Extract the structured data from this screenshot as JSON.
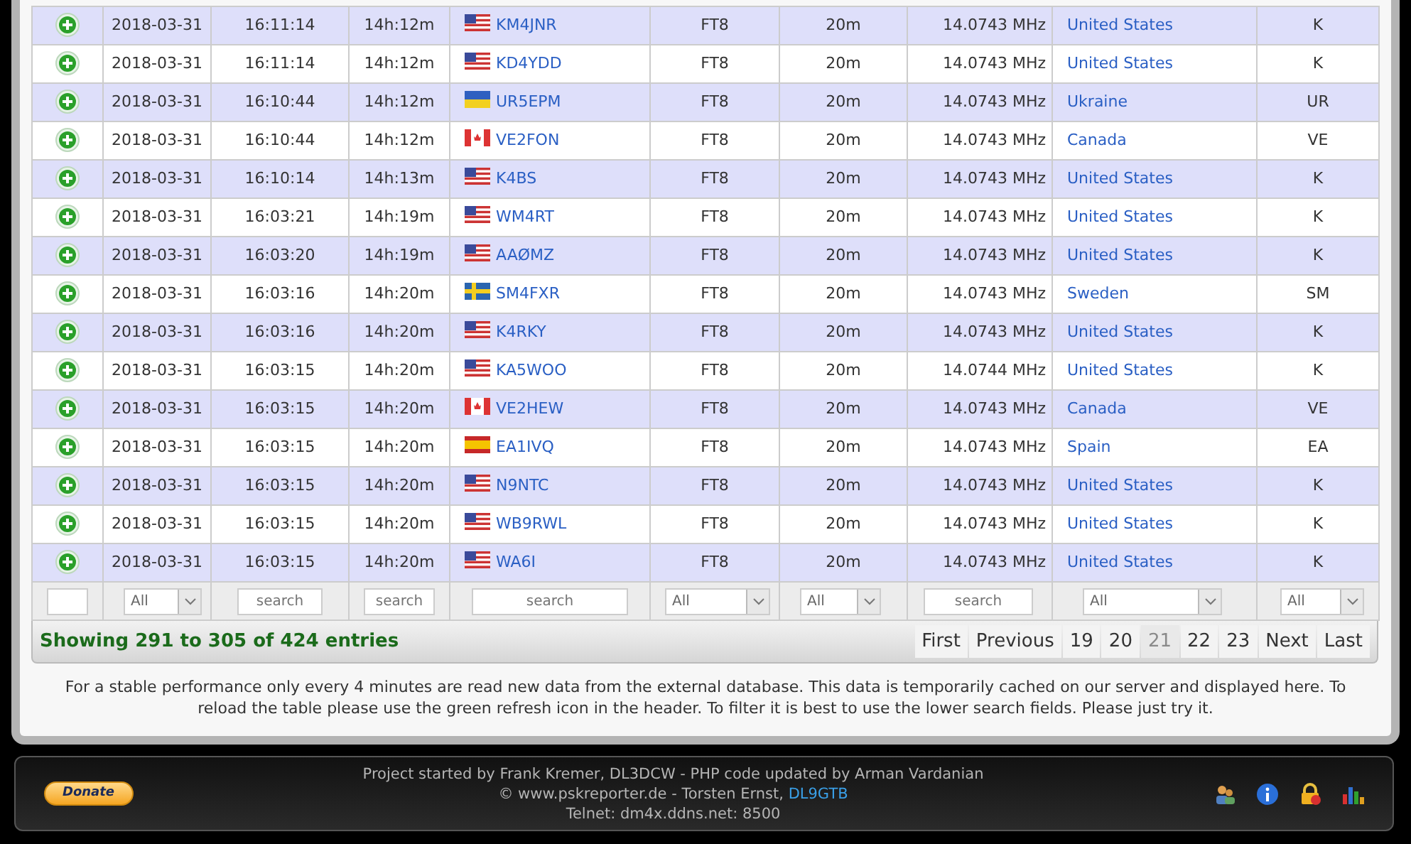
{
  "rows": [
    {
      "date": "2018-03-31",
      "time": "16:11:14",
      "age": "14h:12m",
      "kind": "us",
      "call": "KM4JNR",
      "mode": "FT8",
      "band": "20m",
      "frequency": "14.0743 MHz",
      "country": "United States",
      "prefix": "K"
    },
    {
      "date": "2018-03-31",
      "time": "16:11:14",
      "age": "14h:12m",
      "kind": "us",
      "call": "KD4YDD",
      "mode": "FT8",
      "band": "20m",
      "frequency": "14.0743 MHz",
      "country": "United States",
      "prefix": "K"
    },
    {
      "date": "2018-03-31",
      "time": "16:10:44",
      "age": "14h:12m",
      "kind": "ua",
      "call": "UR5EPM",
      "mode": "FT8",
      "band": "20m",
      "frequency": "14.0743 MHz",
      "country": "Ukraine",
      "prefix": "UR"
    },
    {
      "date": "2018-03-31",
      "time": "16:10:44",
      "age": "14h:12m",
      "kind": "ca",
      "call": "VE2FON",
      "mode": "FT8",
      "band": "20m",
      "frequency": "14.0743 MHz",
      "country": "Canada",
      "prefix": "VE"
    },
    {
      "date": "2018-03-31",
      "time": "16:10:14",
      "age": "14h:13m",
      "kind": "us",
      "call": "K4BS",
      "mode": "FT8",
      "band": "20m",
      "frequency": "14.0743 MHz",
      "country": "United States",
      "prefix": "K"
    },
    {
      "date": "2018-03-31",
      "time": "16:03:21",
      "age": "14h:19m",
      "kind": "us",
      "call": "WM4RT",
      "mode": "FT8",
      "band": "20m",
      "frequency": "14.0743 MHz",
      "country": "United States",
      "prefix": "K"
    },
    {
      "date": "2018-03-31",
      "time": "16:03:20",
      "age": "14h:19m",
      "kind": "us",
      "call": "AAØMZ",
      "mode": "FT8",
      "band": "20m",
      "frequency": "14.0743 MHz",
      "country": "United States",
      "prefix": "K"
    },
    {
      "date": "2018-03-31",
      "time": "16:03:16",
      "age": "14h:20m",
      "kind": "se",
      "call": "SM4FXR",
      "mode": "FT8",
      "band": "20m",
      "frequency": "14.0743 MHz",
      "country": "Sweden",
      "prefix": "SM"
    },
    {
      "date": "2018-03-31",
      "time": "16:03:16",
      "age": "14h:20m",
      "kind": "us",
      "call": "K4RKY",
      "mode": "FT8",
      "band": "20m",
      "frequency": "14.0743 MHz",
      "country": "United States",
      "prefix": "K"
    },
    {
      "date": "2018-03-31",
      "time": "16:03:15",
      "age": "14h:20m",
      "kind": "us",
      "call": "KA5WOO",
      "mode": "FT8",
      "band": "20m",
      "frequency": "14.0744 MHz",
      "country": "United States",
      "prefix": "K"
    },
    {
      "date": "2018-03-31",
      "time": "16:03:15",
      "age": "14h:20m",
      "kind": "ca",
      "call": "VE2HEW",
      "mode": "FT8",
      "band": "20m",
      "frequency": "14.0743 MHz",
      "country": "Canada",
      "prefix": "VE"
    },
    {
      "date": "2018-03-31",
      "time": "16:03:15",
      "age": "14h:20m",
      "kind": "es",
      "call": "EA1IVQ",
      "mode": "FT8",
      "band": "20m",
      "frequency": "14.0743 MHz",
      "country": "Spain",
      "prefix": "EA"
    },
    {
      "date": "2018-03-31",
      "time": "16:03:15",
      "age": "14h:20m",
      "kind": "us",
      "call": "N9NTC",
      "mode": "FT8",
      "band": "20m",
      "frequency": "14.0743 MHz",
      "country": "United States",
      "prefix": "K"
    },
    {
      "date": "2018-03-31",
      "time": "16:03:15",
      "age": "14h:20m",
      "kind": "us",
      "call": "WB9RWL",
      "mode": "FT8",
      "band": "20m",
      "frequency": "14.0743 MHz",
      "country": "United States",
      "prefix": "K"
    },
    {
      "date": "2018-03-31",
      "time": "16:03:15",
      "age": "14h:20m",
      "kind": "us",
      "call": "WA6I",
      "mode": "FT8",
      "band": "20m",
      "frequency": "14.0743 MHz",
      "country": "United States",
      "prefix": "K"
    }
  ],
  "filters": [
    {
      "kind": "text"
    },
    {
      "kind": "select",
      "value": "All"
    },
    {
      "kind": "text",
      "placeholder": "search"
    },
    {
      "kind": "text",
      "placeholder": "search"
    },
    {
      "kind": "text",
      "placeholder": "search"
    },
    {
      "kind": "select",
      "value": "All"
    },
    {
      "kind": "select",
      "value": "All"
    },
    {
      "kind": "text",
      "placeholder": "search"
    },
    {
      "kind": "select",
      "value": "All"
    },
    {
      "kind": "select",
      "value": "All"
    }
  ],
  "info": "Showing 291 to 305 of 424 entries",
  "pagination": [
    {
      "label": "First",
      "selected": false
    },
    {
      "label": "Previous",
      "selected": false
    },
    {
      "label": "19",
      "selected": false
    },
    {
      "label": "20",
      "selected": false
    },
    {
      "label": "21",
      "selected": true
    },
    {
      "label": "22",
      "selected": false
    },
    {
      "label": "23",
      "selected": false
    },
    {
      "label": "Next",
      "selected": false
    },
    {
      "label": "Last",
      "selected": false
    }
  ],
  "notice": "For a stable performance only every 4 minutes are read new data from the external database. This data is temporarily cached on our server and displayed here. To reload the table please use the green refresh icon in the header. To filter it is best to use the lower search fields. Please just try it.",
  "footer": {
    "donate": "Donate",
    "line_1": "Project started by Frank Kremer, DL3DCW - PHP code updated by Arman Vardanian",
    "line_2": "© www.pskreporter.de - Torsten Ernst, ",
    "line_2_link": "DL9GTB",
    "line_3": "Telnet: dm4x.ddns.net: 8500"
  }
}
